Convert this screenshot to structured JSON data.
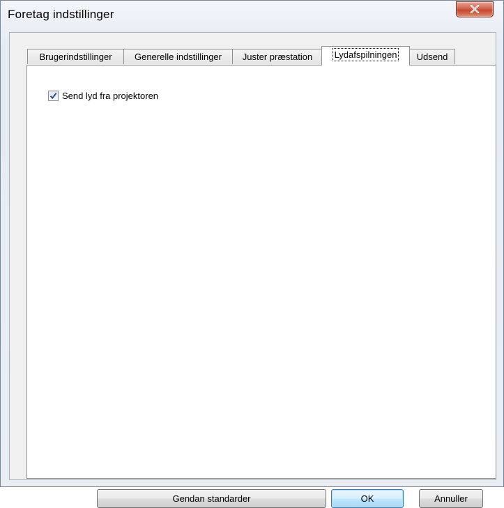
{
  "window": {
    "title": "Foretag indstillinger",
    "close_icon": "close-icon"
  },
  "tabs": [
    {
      "label": "Brugerindstillinger",
      "active": false
    },
    {
      "label": "Generelle indstillinger",
      "active": false
    },
    {
      "label": "Juster præstation",
      "active": false
    },
    {
      "label": "Lydafspilningen",
      "active": true
    },
    {
      "label": "Udsend",
      "active": false
    }
  ],
  "panel": {
    "checkbox": {
      "label": "Send lyd fra projektoren",
      "checked": true
    }
  },
  "buttons": {
    "restore_defaults": "Gendan standarder",
    "ok": "OK",
    "cancel": "Annuller"
  },
  "colors": {
    "close_button": "#c7462d",
    "default_button_border": "#3c7fb1",
    "checkmark": "#2a4f8f"
  }
}
